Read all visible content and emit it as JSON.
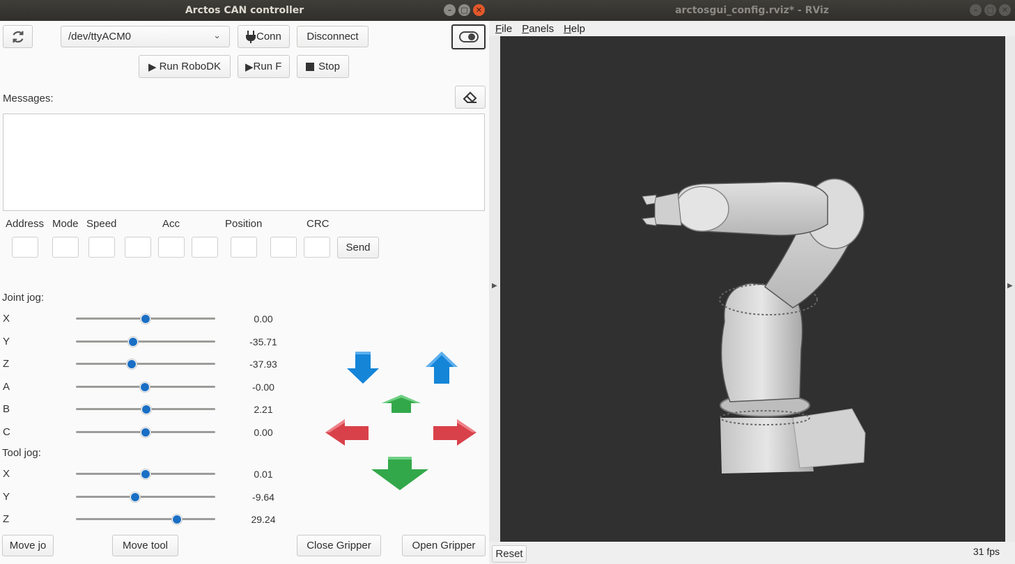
{
  "left_window": {
    "title": "Arctos CAN controller",
    "port_select": "/dev/ttyACM0",
    "buttons": {
      "connect": "Conn",
      "disconnect": "Disconnect",
      "run_robodk": "Run RoboDK",
      "run_f": "Run F",
      "stop": "Stop",
      "send": "Send",
      "move_joint": "Move jo",
      "move_tool": "Move tool",
      "close_gripper": "Close Gripper",
      "open_gripper": "Open Gripper"
    },
    "messages_label": "Messages:",
    "messages_text": "",
    "can_headers": [
      "Address",
      "Mode",
      "Speed",
      "Acc",
      "Position",
      "CRC"
    ],
    "joint_jog": {
      "label": "Joint jog:",
      "rows": [
        {
          "name": "X",
          "value": "0.00",
          "pos": 0.5
        },
        {
          "name": "Y",
          "value": "-35.71",
          "pos": 0.41
        },
        {
          "name": "Z",
          "value": "-37.93",
          "pos": 0.4
        },
        {
          "name": "A",
          "value": "-0.00",
          "pos": 0.495
        },
        {
          "name": "B",
          "value": "2.21",
          "pos": 0.505
        },
        {
          "name": "C",
          "value": "0.00",
          "pos": 0.5
        }
      ]
    },
    "tool_jog": {
      "label": "Tool jog:",
      "rows": [
        {
          "name": "X",
          "value": "0.01",
          "pos": 0.5
        },
        {
          "name": "Y",
          "value": "-9.64",
          "pos": 0.425
        },
        {
          "name": "Z",
          "value": "29.24",
          "pos": 0.725
        }
      ]
    },
    "colors": {
      "arrow_blue": "#1585d8",
      "arrow_green": "#33a84a",
      "arrow_red": "#d9414a",
      "slider_knob": "#1a6fc4"
    }
  },
  "right_window": {
    "title": "arctosgui_config.rviz* - RViz",
    "menu": [
      "File",
      "Panels",
      "Help"
    ],
    "reset_button": "Reset",
    "fps": "31 fps"
  }
}
